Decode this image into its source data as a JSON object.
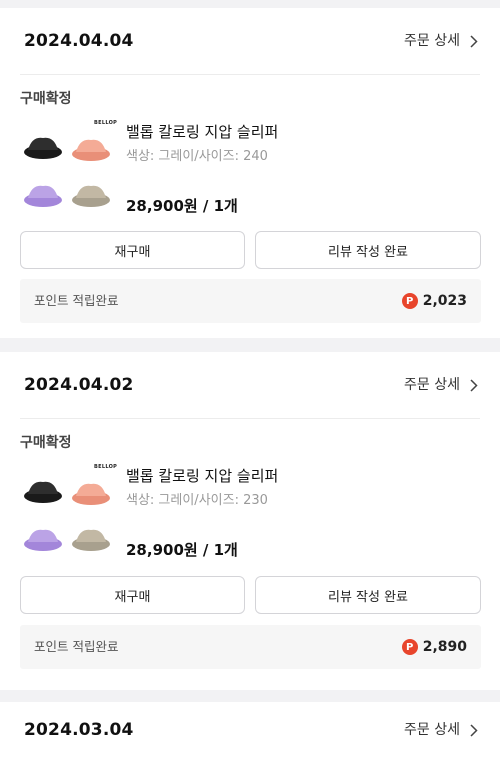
{
  "orders": [
    {
      "date": "2024.04.04",
      "detail_label": "주문 상세",
      "status": "구매확정",
      "brand_mark": "BELLOP",
      "product_name": "밸롭 칼로링 지압 슬리퍼",
      "option": "색상: 그레이/사이즈: 240",
      "price_qty": "28,900원 / 1개",
      "reorder_label": "재구매",
      "review_label": "리뷰 작성 완료",
      "points_label": "포인트 적립완료",
      "points_icon": "P",
      "points_value": "2,023"
    },
    {
      "date": "2024.04.02",
      "detail_label": "주문 상세",
      "status": "구매확정",
      "brand_mark": "BELLOP",
      "product_name": "밸롭 칼로링 지압 슬리퍼",
      "option": "색상: 그레이/사이즈: 230",
      "price_qty": "28,900원 / 1개",
      "reorder_label": "재구매",
      "review_label": "리뷰 작성 완료",
      "points_label": "포인트 적립완료",
      "points_icon": "P",
      "points_value": "2,890"
    },
    {
      "date": "2024.03.04",
      "detail_label": "주문 상세"
    }
  ],
  "colors": {
    "background": "#f2f2f4",
    "points_icon": "#e8452c",
    "slipper_black": "#222222",
    "slipper_pink": "#f2a48e",
    "slipper_purple": "#b49be0",
    "slipper_gray": "#b8ac98"
  },
  "icons": {
    "detail_chevron": "chevron-right-icon",
    "points": "points-coin-icon"
  }
}
